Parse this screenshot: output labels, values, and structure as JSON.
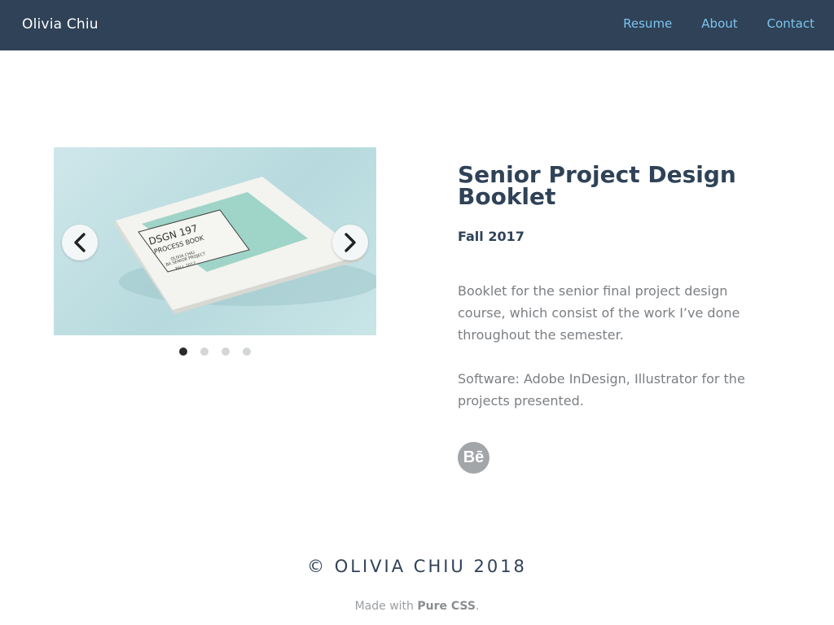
{
  "header": {
    "brand": "Olivia Chiu",
    "nav": [
      {
        "label": "Resume"
      },
      {
        "label": "About"
      },
      {
        "label": "Contact"
      }
    ]
  },
  "carousel": {
    "slide_text": {
      "title": "DSGN 197",
      "subtitle": "PROCESS BOOK",
      "line1": "OLIVIA CHIU",
      "line2": "BA SENIOR PROJECT",
      "line3": "FALL 2017"
    },
    "prev_icon": "chevron-left-icon",
    "next_icon": "chevron-right-icon",
    "dots_count": 4,
    "active_index": 0
  },
  "project": {
    "title": "Senior Project Design Booklet",
    "date": "Fall 2017",
    "description": "Booklet for the senior final project design course, which consist of the work I’ve done throughout the semester.",
    "software": "Software: Adobe InDesign, Illustrator for the projects presented.",
    "behance_icon_text": "Bē"
  },
  "footer": {
    "copyright": "© OLIVIA CHIU 2018",
    "made_with_prefix": "Made with ",
    "made_with_link": "Pure CSS",
    "made_with_suffix": "."
  },
  "colors": {
    "header_bg": "#2f4257",
    "nav_link": "#7cc4ee",
    "heading": "#2f4257",
    "body_text": "#7b7f83",
    "slide_bg": "#b7dade"
  }
}
